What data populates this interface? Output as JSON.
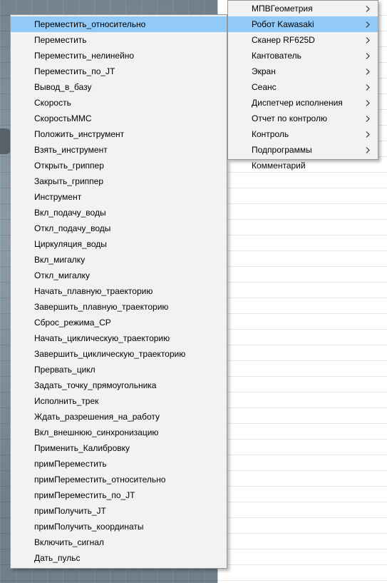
{
  "left_menu": {
    "items": [
      {
        "label": "Переместить_относительно",
        "selected": true
      },
      {
        "label": "Переместить"
      },
      {
        "label": "Переместить_нелинейно"
      },
      {
        "label": "Переместить_по_JT"
      },
      {
        "label": "Вывод_в_базу"
      },
      {
        "label": "Скорость"
      },
      {
        "label": "СкоростьММС"
      },
      {
        "label": "Положить_инструмент"
      },
      {
        "label": "Взять_инструмент"
      },
      {
        "label": "Открыть_гриппер"
      },
      {
        "label": "Закрыть_гриппер"
      },
      {
        "label": "Инструмент"
      },
      {
        "label": "Вкл_подачу_воды"
      },
      {
        "label": "Откл_подачу_воды"
      },
      {
        "label": "Циркуляция_воды"
      },
      {
        "label": "Вкл_мигалку"
      },
      {
        "label": "Откл_мигалку"
      },
      {
        "label": "Начать_плавную_траекторию"
      },
      {
        "label": "Завершить_плавную_траекторию"
      },
      {
        "label": "Сброс_режима_СР"
      },
      {
        "label": "Начать_циклическую_траекторию"
      },
      {
        "label": "Завершить_циклическую_траекторию"
      },
      {
        "label": "Прервать_цикл"
      },
      {
        "label": "Задать_точку_прямоугольника"
      },
      {
        "label": "Исполнить_трек"
      },
      {
        "label": "Ждать_разрешения_на_работу"
      },
      {
        "label": "Вкл_внешнюю_синхронизацию"
      },
      {
        "label": "Применить_Калибровку"
      },
      {
        "label": "примПереместить"
      },
      {
        "label": "примПереместить_относительно"
      },
      {
        "label": "примПереместить_по_JT"
      },
      {
        "label": "примПолучить_JT"
      },
      {
        "label": "примПолучить_координаты"
      },
      {
        "label": "Включить_сигнал"
      },
      {
        "label": "Дать_пульс"
      }
    ]
  },
  "right_menu": {
    "items": [
      {
        "label": "МПВГеометрия",
        "submenu": true
      },
      {
        "label": "Робот Kawasaki",
        "submenu": true,
        "selected": true
      },
      {
        "label": "Сканер RF625D",
        "submenu": true
      },
      {
        "label": "Кантователь",
        "submenu": true
      },
      {
        "label": "Экран",
        "submenu": true
      },
      {
        "label": "Сеанс",
        "submenu": true
      },
      {
        "label": "Диспетчер исполнения",
        "submenu": true
      },
      {
        "label": "Отчет по контролю",
        "submenu": true
      },
      {
        "label": "Контроль",
        "submenu": true
      },
      {
        "label": "Подпрограммы",
        "submenu": true
      },
      {
        "label": "Комментарий",
        "submenu": false
      }
    ]
  },
  "colors": {
    "selection": "#91c9f7",
    "menu_bg": "#f2f2f2",
    "menu_border": "#979797"
  },
  "icons": {
    "submenu_arrow": "chevron-right-icon"
  }
}
